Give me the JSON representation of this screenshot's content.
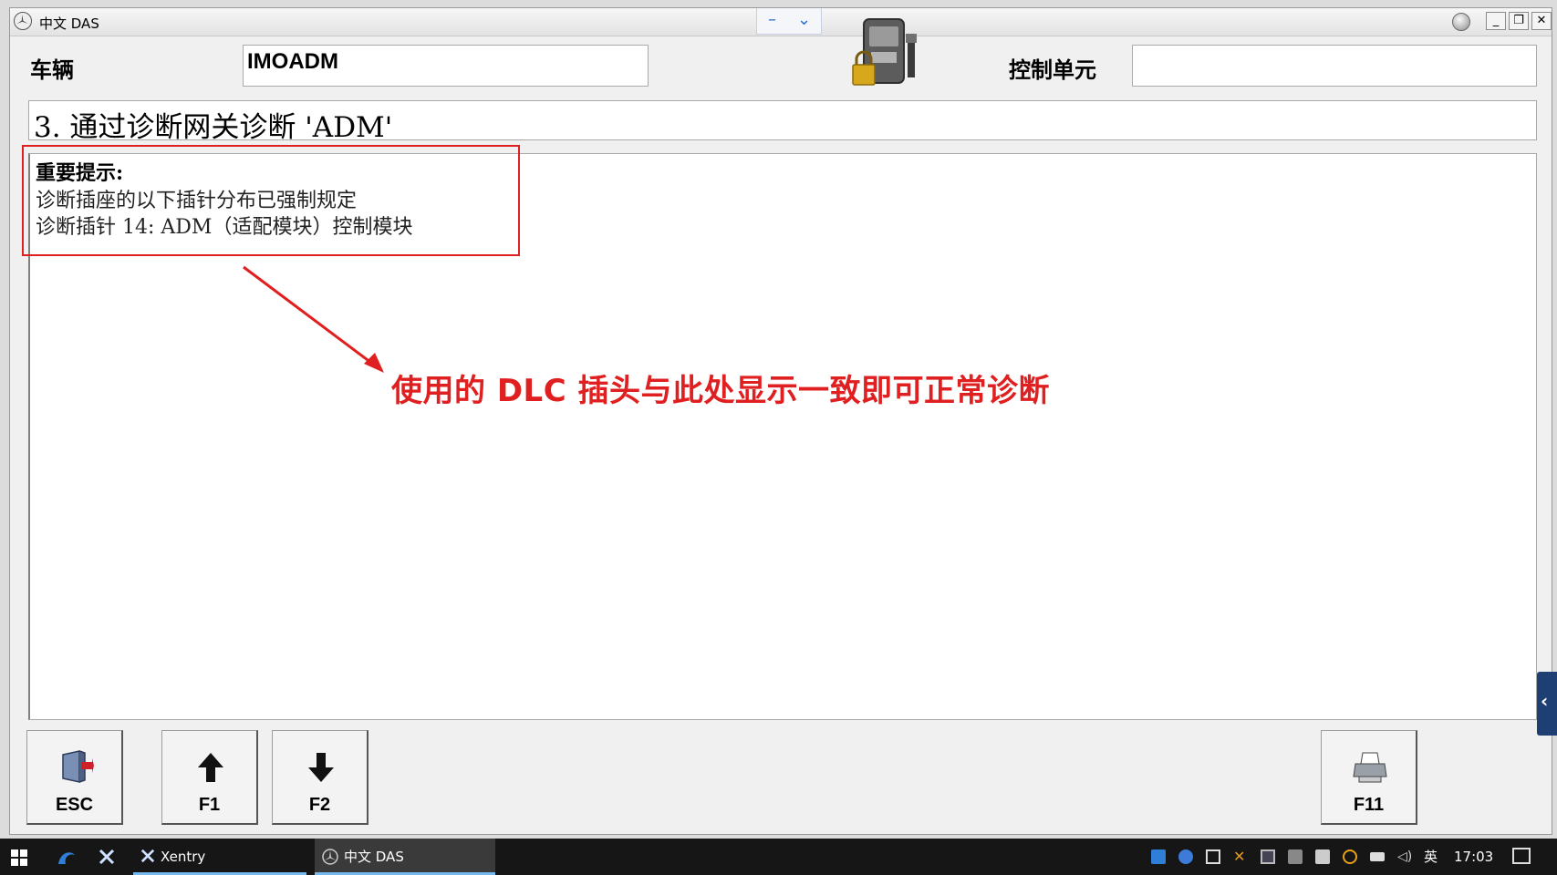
{
  "window": {
    "title": "中文 DAS",
    "controls": {
      "minimize": "_",
      "restore": "❐",
      "close": "✕"
    }
  },
  "remote_tab": {
    "minimize": "–",
    "expand": "⌄"
  },
  "header": {
    "vehicle_label": "车辆",
    "vehicle_value": "IMOADM",
    "control_unit_label": "控制单元",
    "control_unit_value": ""
  },
  "step_title": "3. 通过诊断网关诊断 'ADM'",
  "note": {
    "title": "重要提示:",
    "line1": "诊断插座的以下插针分布已强制规定",
    "line2": "诊断插针 14: ADM（适配模块）控制模块"
  },
  "annotation": {
    "text": "使用的 DLC 插头与此处显示一致即可正常诊断",
    "color": "#e02020"
  },
  "buttons": [
    {
      "label": "ESC",
      "icon": "exit-door-icon"
    },
    {
      "label": "F1",
      "icon": "arrow-up-icon"
    },
    {
      "label": "F2",
      "icon": "arrow-down-icon"
    },
    {
      "label": "F11",
      "icon": "printer-icon"
    }
  ],
  "side_tab": {
    "glyph": "‹"
  },
  "taskbar": {
    "items": [
      {
        "label": "Xentry",
        "icon": "xentry-icon"
      },
      {
        "label": "中文 DAS",
        "icon": "mercedes-star-icon"
      }
    ],
    "ime": "英",
    "time": "17:03"
  }
}
